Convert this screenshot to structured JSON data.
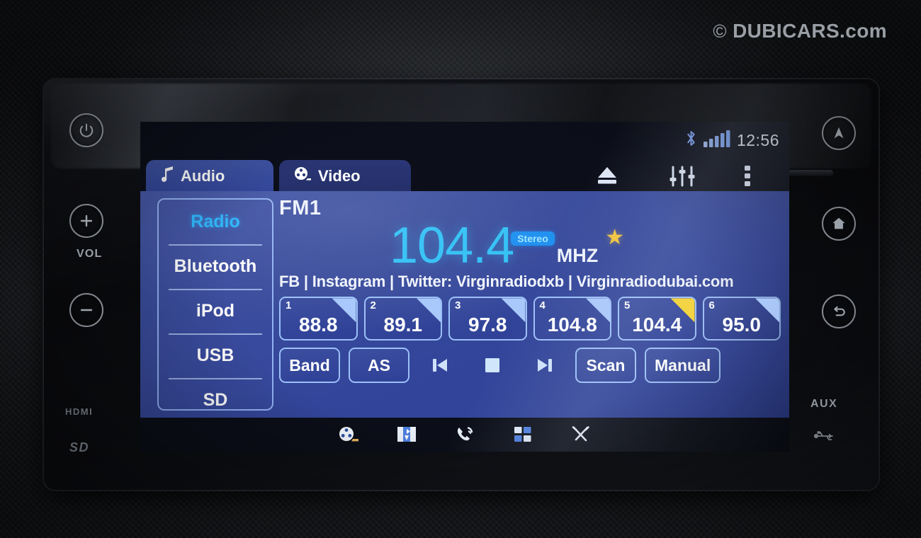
{
  "watermark": {
    "symbol": "©",
    "text": "DUBICARS.com"
  },
  "statusbar": {
    "bluetooth_icon": "bluetooth-icon",
    "signal_icon": "signal-bars-icon",
    "clock": "12:56"
  },
  "tabs": [
    {
      "label": "Audio",
      "icon": "music-note-icon",
      "selected": true
    },
    {
      "label": "Video",
      "icon": "film-reel-icon",
      "selected": false
    }
  ],
  "toolbar": [
    {
      "name": "eject-icon",
      "label": "Eject"
    },
    {
      "name": "equalizer-icon",
      "label": "Equalizer"
    },
    {
      "name": "more-menu-icon",
      "label": "More"
    }
  ],
  "sources": [
    {
      "label": "Radio",
      "selected": true
    },
    {
      "label": "Bluetooth",
      "selected": false
    },
    {
      "label": "iPod",
      "selected": false
    },
    {
      "label": "USB",
      "selected": false
    },
    {
      "label": "SD",
      "selected": false
    }
  ],
  "radio": {
    "band": "FM1",
    "frequency": "104.4",
    "unit": "MHZ",
    "stereo_badge": "Stereo",
    "favorite_icon": "star-icon",
    "rds_text": "FB | Instagram | Twitter: Virginradiodxb | Virginradiodubai.com"
  },
  "presets": [
    {
      "number": "1",
      "frequency": "88.8",
      "active": false
    },
    {
      "number": "2",
      "frequency": "89.1",
      "active": false
    },
    {
      "number": "3",
      "frequency": "97.8",
      "active": false
    },
    {
      "number": "4",
      "frequency": "104.8",
      "active": false
    },
    {
      "number": "5",
      "frequency": "104.4",
      "active": true
    },
    {
      "number": "6",
      "frequency": "95.0",
      "active": false
    }
  ],
  "controls": {
    "band": "Band",
    "as": "AS",
    "prev_icon": "previous-track-icon",
    "stop_icon": "stop-icon",
    "next_icon": "next-track-icon",
    "scan": "Scan",
    "manual": "Manual"
  },
  "navbar": [
    {
      "name": "media-icon",
      "label": "Media"
    },
    {
      "name": "navigation-map-icon",
      "label": "Navigation"
    },
    {
      "name": "phone-icon",
      "label": "Phone"
    },
    {
      "name": "apps-grid-icon",
      "label": "Apps"
    },
    {
      "name": "tools-settings-icon",
      "label": "Settings"
    }
  ],
  "bezel_left": {
    "power": "power-icon",
    "vol_up": "volume-up-icon",
    "vol_label": "VOL",
    "vol_down": "volume-down-icon",
    "hdmi": "HDMI",
    "sd": "SD"
  },
  "bezel_right": {
    "navigation": "navigation-arrow-icon",
    "home": "home-icon",
    "back": "back-icon",
    "aux": "AUX",
    "usb": "usb-icon"
  },
  "colors": {
    "accent_cyan": "#2fc0f5",
    "panel_blue": "#33459a",
    "border_blue": "#9cc0f8",
    "active_yellow": "#f5d233",
    "stereo_blue": "#1b8ef0"
  }
}
